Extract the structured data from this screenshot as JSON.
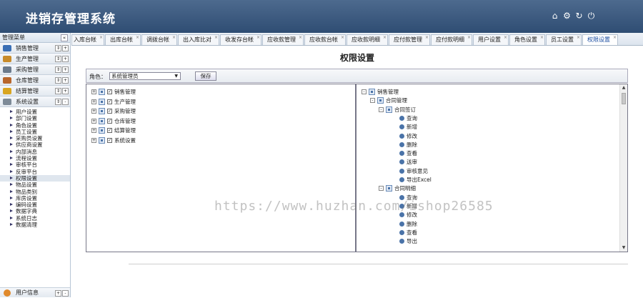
{
  "app": {
    "title": "进销存管理系统"
  },
  "header_icons": [
    "home-icon",
    "gear-icon",
    "refresh-icon",
    "power-icon"
  ],
  "sidebar": {
    "title": "管理菜单",
    "collapse": "«",
    "groups": [
      {
        "label": "销售管理",
        "color": "#3a6fb5"
      },
      {
        "label": "生产管理",
        "color": "#c88b2a"
      },
      {
        "label": "采购管理",
        "color": "#6b7a8c"
      },
      {
        "label": "仓库管理",
        "color": "#b8662c"
      },
      {
        "label": "结算管理",
        "color": "#d9a520"
      },
      {
        "label": "系统设置",
        "color": "#7d8a97"
      }
    ],
    "items": [
      "用户设置",
      "部门设置",
      "角色设置",
      "员工设置",
      "采购员设置",
      "供应商设置",
      "内部消息",
      "流程设置",
      "审核平台",
      "反审平台",
      "权限设置",
      "物品设置",
      "物品类别",
      "库房设置",
      "编码设置",
      "数据字典",
      "系统日志",
      "数据清理"
    ],
    "active_item": "权限设置",
    "user_info": "用户信息"
  },
  "tabs": [
    "入库台帐",
    "出库台帐",
    "调拨台帐",
    "出入库比对",
    "收发存台帐",
    "应收款管理",
    "应收款台帐",
    "应收款明细",
    "应付款管理",
    "应付款明细",
    "用户设置",
    "角色设置",
    "员工设置",
    "权限设置"
  ],
  "active_tab": "权限设置",
  "page": {
    "title": "权限设置",
    "role_label": "角色：",
    "role_value": "系统管理员",
    "save_label": "保存"
  },
  "left_tree": [
    "销售管理",
    "生产管理",
    "采购管理",
    "仓库管理",
    "结算管理",
    "系统设置"
  ],
  "right_tree": {
    "root": "销售管理",
    "nodes": [
      {
        "label": "合同管理",
        "level": 1
      },
      {
        "label": "合同签订",
        "level": 2
      },
      {
        "label": "查询",
        "level": 3
      },
      {
        "label": "新增",
        "level": 3
      },
      {
        "label": "修改",
        "level": 3
      },
      {
        "label": "删除",
        "level": 3
      },
      {
        "label": "查看",
        "level": 3
      },
      {
        "label": "送审",
        "level": 3
      },
      {
        "label": "审核意见",
        "level": 3
      },
      {
        "label": "导出Excel",
        "level": 3
      },
      {
        "label": "合同明细",
        "level": 2
      },
      {
        "label": "查询",
        "level": 3
      },
      {
        "label": "新增",
        "level": 3
      },
      {
        "label": "修改",
        "level": 3
      },
      {
        "label": "删除",
        "level": 3
      },
      {
        "label": "查看",
        "level": 3
      },
      {
        "label": "导出",
        "level": 3
      }
    ]
  },
  "watermark": "https://www.huzhan.com/ishop26585"
}
